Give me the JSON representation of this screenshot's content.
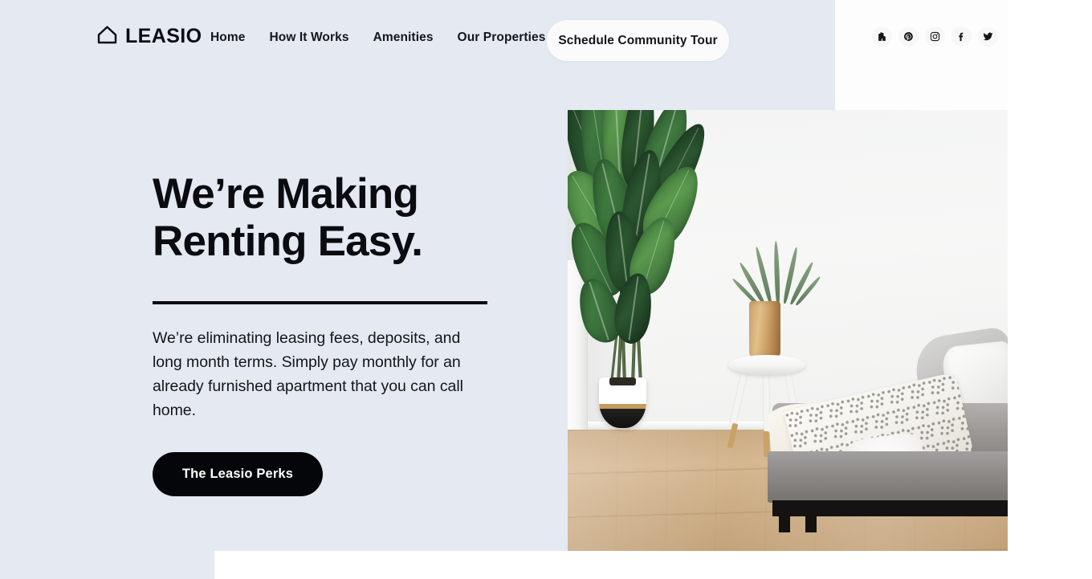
{
  "brand": {
    "name": "LEASIO",
    "icon": "home-outline-icon"
  },
  "nav": {
    "items": [
      {
        "label": "Home",
        "name": "nav-link-home"
      },
      {
        "label": "How It Works",
        "name": "nav-link-how-it-works"
      },
      {
        "label": "Amenities",
        "name": "nav-link-amenities"
      },
      {
        "label": "Our Properties",
        "name": "nav-link-our-properties"
      }
    ],
    "cta_label": "Schedule Community Tour"
  },
  "socials": [
    {
      "label": "Houzz",
      "icon": "houzz-icon"
    },
    {
      "label": "Pinterest",
      "icon": "pinterest-icon"
    },
    {
      "label": "Instagram",
      "icon": "instagram-icon"
    },
    {
      "label": "Facebook",
      "icon": "facebook-icon"
    },
    {
      "label": "Twitter",
      "icon": "twitter-icon"
    }
  ],
  "hero": {
    "headline": "We’re Making\nRenting Easy.",
    "headline_line_1": "We’re Making",
    "headline_line_2": "Renting Easy.",
    "body": "We’re eliminating leasing fees, deposits, and long month terms. Simply pay monthly for an already furnished apartment that you can call home.",
    "button_label": "The Leasio Perks",
    "image_alt": "Furnished apartment interior with bird of paradise plant, white tripod side table and grey daybed"
  },
  "colors": {
    "page_background": "#e4e9f2",
    "panel_white": "#ffffff",
    "ink": "#0a0c10",
    "button_dark": "#05060a",
    "button_light": "#fbfbfb",
    "social_chip": "#f7f7f8"
  }
}
